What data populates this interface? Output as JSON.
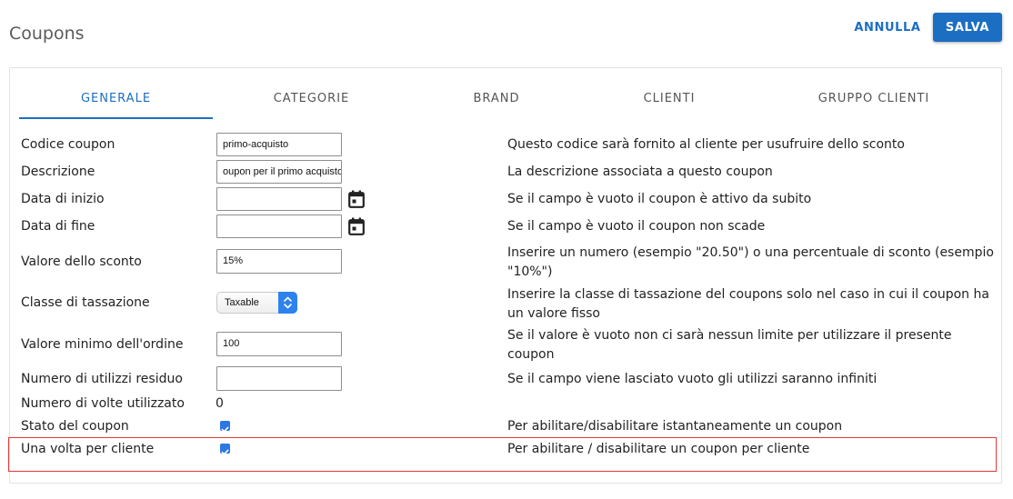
{
  "header": {
    "title": "Coupons",
    "cancel_label": "ANNULLA",
    "save_label": "SALVA"
  },
  "tabs": [
    {
      "label": "GENERALE",
      "active": true
    },
    {
      "label": "CATEGORIE",
      "active": false
    },
    {
      "label": "BRAND",
      "active": false
    },
    {
      "label": "CLIENTI",
      "active": false
    },
    {
      "label": "GRUPPO CLIENTI",
      "active": false
    }
  ],
  "form": {
    "code": {
      "label": "Codice coupon",
      "value": "primo-acquisto",
      "description": "Questo codice sarà fornito al cliente per usufruire dello sconto"
    },
    "description": {
      "label": "Descrizione",
      "value": "oupon per il primo acquisto",
      "description": "La descrizione associata a questo coupon"
    },
    "start_date": {
      "label": "Data di inizio",
      "value": "",
      "icon": "calendar-icon",
      "description": "Se il campo è vuoto il coupon è attivo da subito"
    },
    "end_date": {
      "label": "Data di fine",
      "value": "",
      "icon": "calendar-icon",
      "description": "Se il campo è vuoto il coupon non scade"
    },
    "discount": {
      "label": "Valore dello sconto",
      "value": "15%",
      "description_line1": "Inserire un numero (esempio \"20.50\") o una percentuale di sconto (esempio",
      "description_line2": "\"10%\")"
    },
    "tax_class": {
      "label": "Classe di tassazione",
      "value": "Taxable",
      "description_line1": "Inserire la classe di tassazione del coupons solo nel caso in cui il coupon ha",
      "description_line2": "un valore fisso"
    },
    "min_order": {
      "label": "Valore minimo dell'ordine",
      "value": "100",
      "description_line1": "Se il valore è vuoto non ci sarà nessun limite per utilizzare il presente",
      "description_line2": "coupon"
    },
    "remaining_uses": {
      "label": "Numero di utilizzi residuo",
      "value": "",
      "description": "Se il campo viene lasciato vuoto gli utilizzi saranno infiniti"
    },
    "times_used": {
      "label": "Numero di volte utilizzato",
      "value": "0"
    },
    "status": {
      "label": "Stato del coupon",
      "checked": true,
      "description": "Per abilitare/disabilitare istantaneamente un coupon"
    },
    "once_per_customer": {
      "label": "Una volta per cliente",
      "checked": true,
      "description": "Per abilitare / disabilitare un coupon per cliente"
    }
  },
  "colors": {
    "accent": "#1c6ec2",
    "checkbox": "#2b78e4",
    "highlight": "#e23a3a"
  }
}
